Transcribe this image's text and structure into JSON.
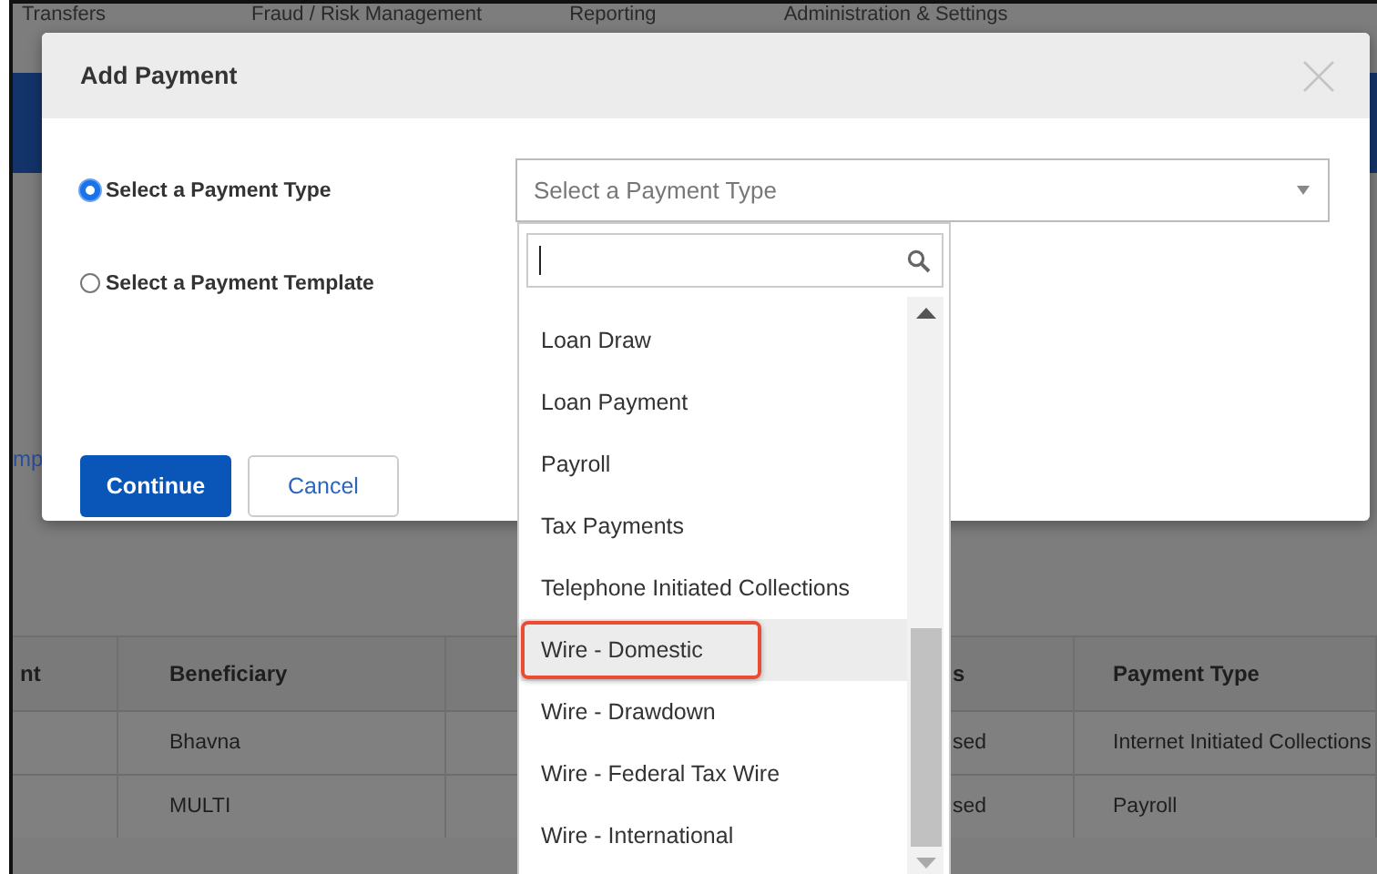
{
  "nav": {
    "items": [
      "Transfers",
      "Fraud / Risk Management",
      "Reporting",
      "Administration & Settings"
    ]
  },
  "background": {
    "link_fragment": "mp",
    "table": {
      "columns": [
        "nt",
        "Beneficiary",
        "",
        "s",
        "Payment Type"
      ],
      "rows": [
        [
          "",
          "Bhavna",
          "",
          "sed",
          "Internet Initiated Collections"
        ],
        [
          "",
          "MULTI",
          "",
          "sed",
          "Payroll"
        ]
      ]
    }
  },
  "modal": {
    "title": "Add Payment",
    "options": [
      {
        "label": "Select a Payment Type",
        "selected": true
      },
      {
        "label": "Select a Payment Template",
        "selected": false
      }
    ],
    "select": {
      "placeholder": "Select a Payment Type"
    },
    "dropdown": {
      "items": [
        {
          "label": "Loan Draw",
          "selected": false,
          "annotated": false
        },
        {
          "label": "Loan Payment",
          "selected": false,
          "annotated": false
        },
        {
          "label": "Payroll",
          "selected": false,
          "annotated": false
        },
        {
          "label": "Tax Payments",
          "selected": false,
          "annotated": false
        },
        {
          "label": "Telephone Initiated Collections",
          "selected": false,
          "annotated": false
        },
        {
          "label": "Wire - Domestic",
          "selected": true,
          "annotated": true
        },
        {
          "label": "Wire - Drawdown",
          "selected": false,
          "annotated": false
        },
        {
          "label": "Wire - Federal Tax Wire",
          "selected": false,
          "annotated": false
        },
        {
          "label": "Wire - International",
          "selected": false,
          "annotated": false
        }
      ]
    },
    "buttons": [
      {
        "label": "Continue",
        "kind": "primary"
      },
      {
        "label": "Cancel",
        "kind": "secondary"
      }
    ]
  }
}
